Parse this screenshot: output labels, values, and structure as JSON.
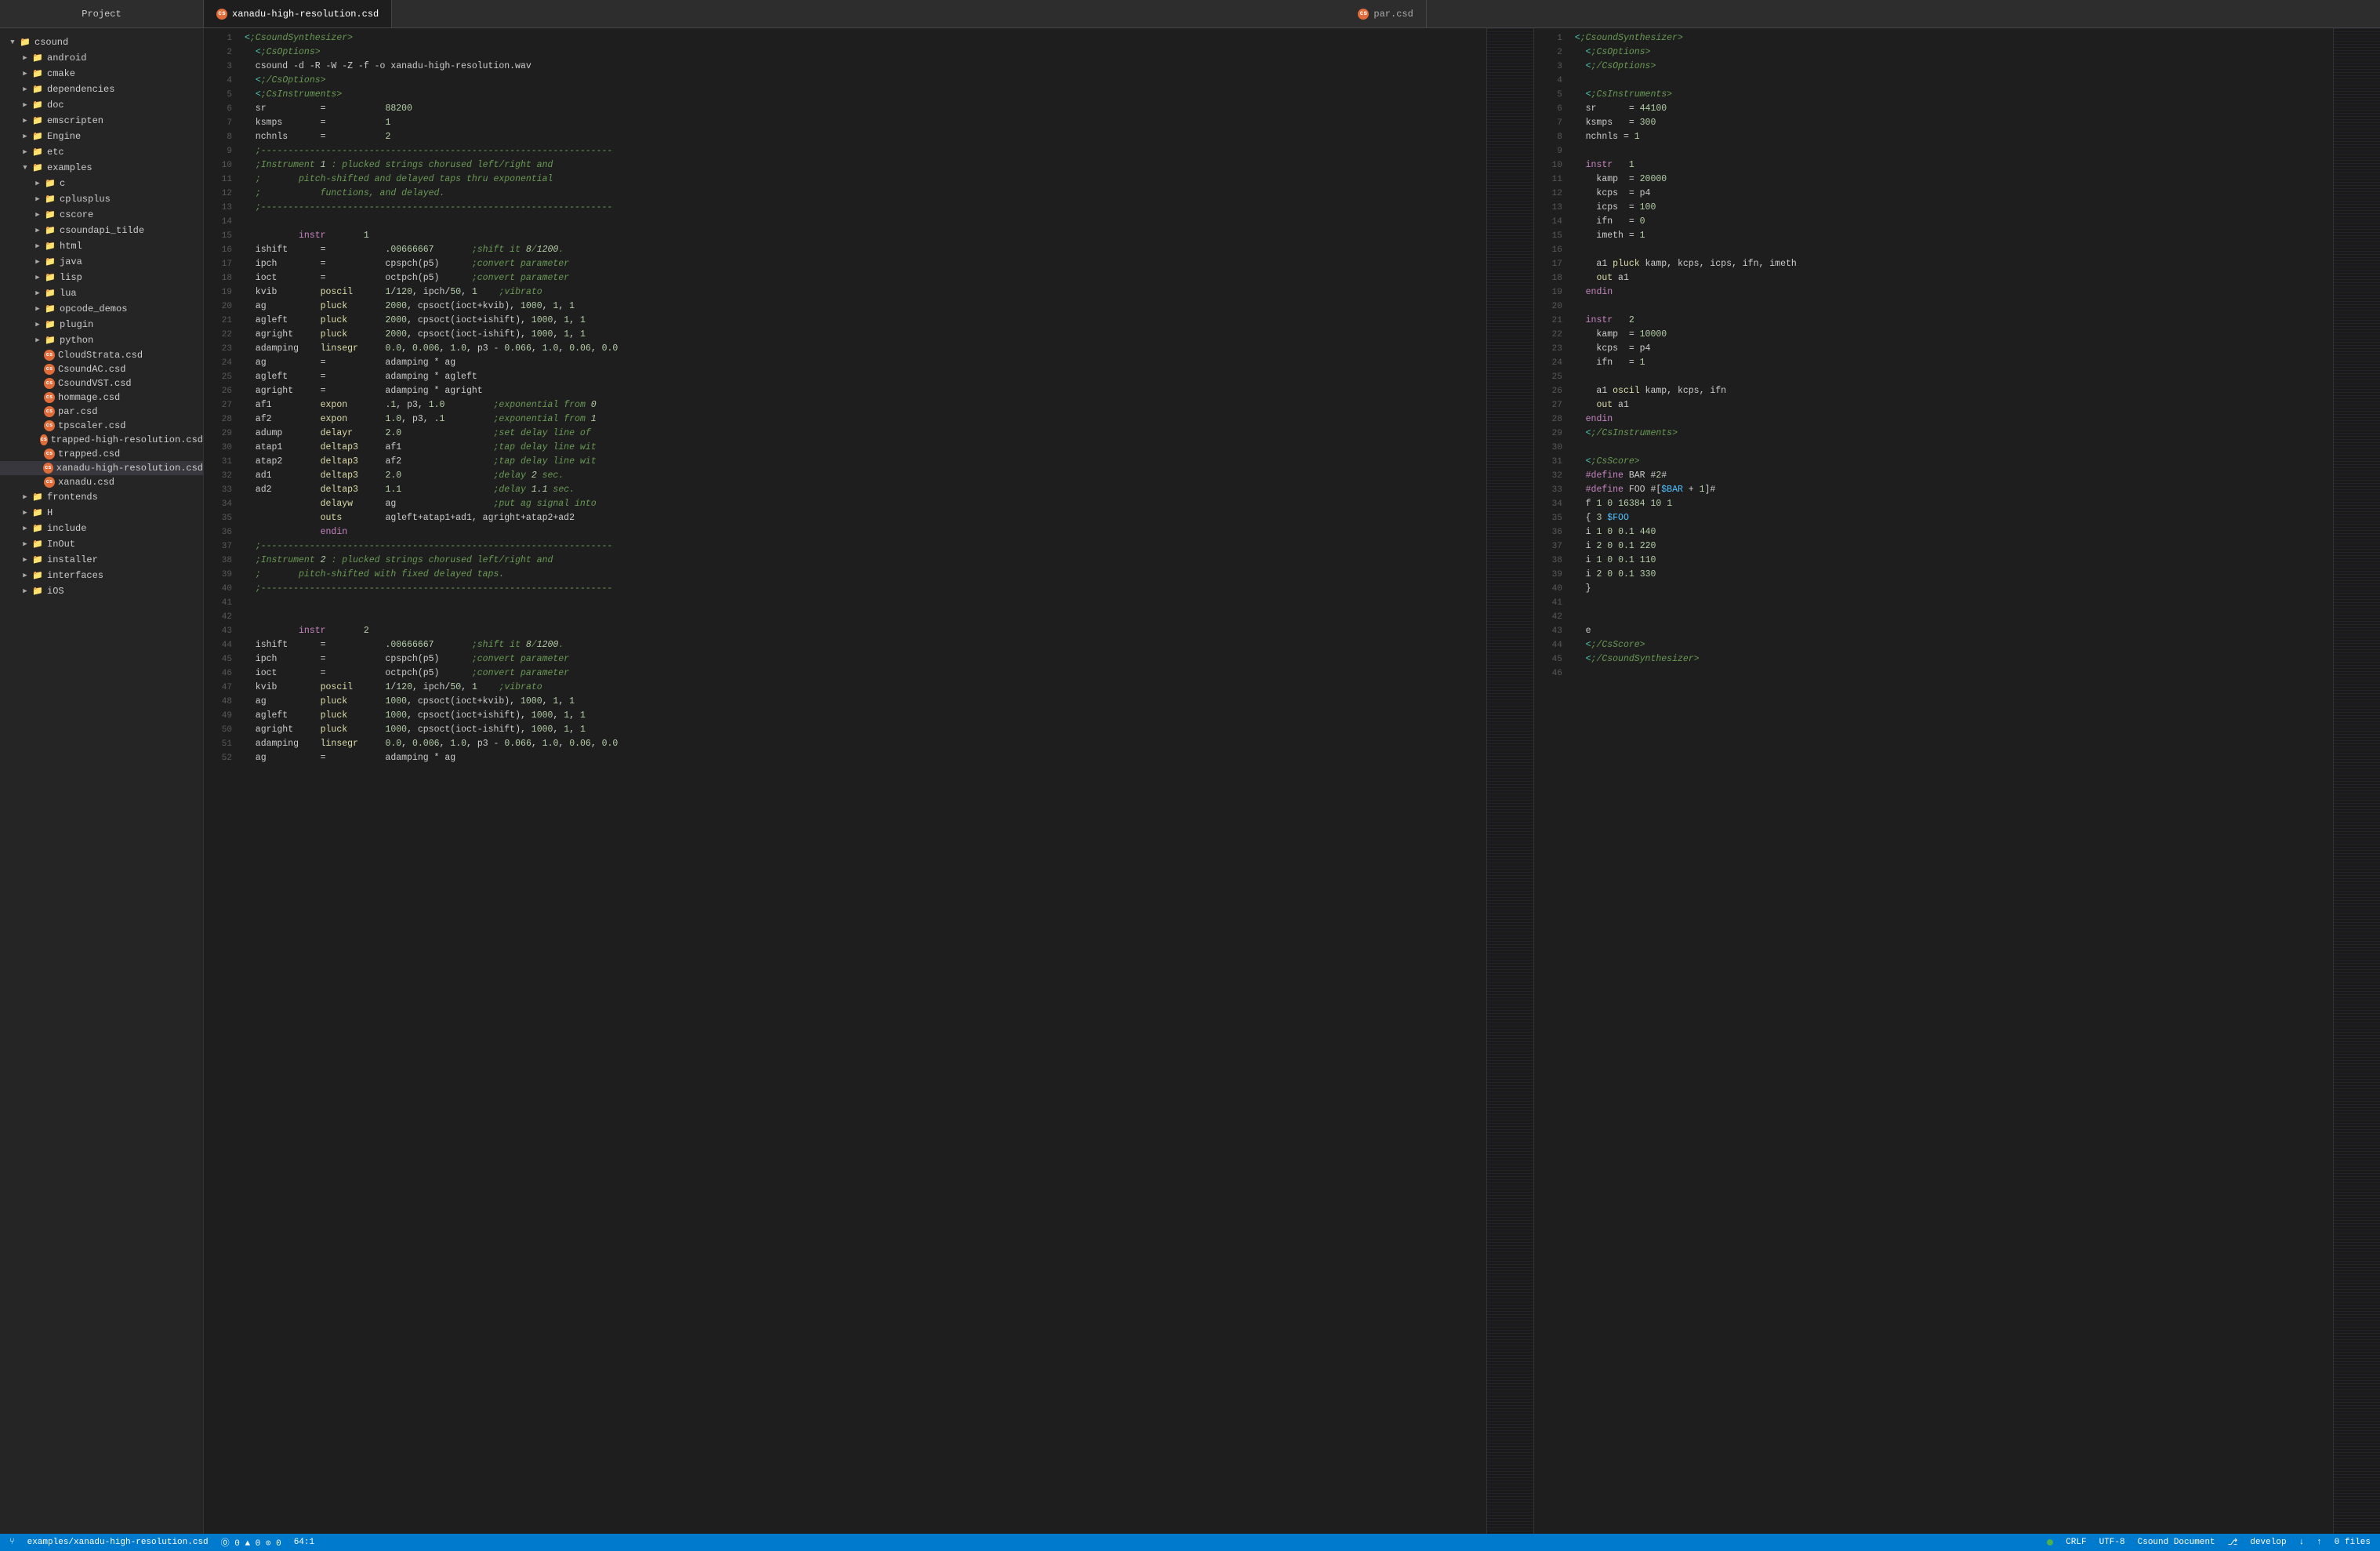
{
  "titleBar": {
    "tabs": [
      {
        "id": "xanadu",
        "label": "xanadu-high-resolution.csd",
        "active": true,
        "hasIcon": true
      },
      {
        "id": "par",
        "label": "par.csd",
        "active": false,
        "hasIcon": true
      }
    ]
  },
  "sidebar": {
    "title": "Project",
    "items": [
      {
        "id": "csound",
        "label": "csound",
        "type": "folder",
        "level": 0,
        "expanded": true,
        "arrow": "▼"
      },
      {
        "id": "android",
        "label": "android",
        "type": "folder",
        "level": 1,
        "expanded": false,
        "arrow": "▶"
      },
      {
        "id": "cmake",
        "label": "cmake",
        "type": "folder",
        "level": 1,
        "expanded": false,
        "arrow": "▶"
      },
      {
        "id": "dependencies",
        "label": "dependencies",
        "type": "folder",
        "level": 1,
        "expanded": false,
        "arrow": "▶"
      },
      {
        "id": "doc",
        "label": "doc",
        "type": "folder",
        "level": 1,
        "expanded": false,
        "arrow": "▶"
      },
      {
        "id": "emscripten",
        "label": "emscripten",
        "type": "folder",
        "level": 1,
        "expanded": false,
        "arrow": "▶"
      },
      {
        "id": "Engine",
        "label": "Engine",
        "type": "folder",
        "level": 1,
        "expanded": false,
        "arrow": "▶"
      },
      {
        "id": "etc",
        "label": "etc",
        "type": "folder",
        "level": 1,
        "expanded": false,
        "arrow": "▶"
      },
      {
        "id": "examples",
        "label": "examples",
        "type": "folder",
        "level": 1,
        "expanded": true,
        "arrow": "▼"
      },
      {
        "id": "c",
        "label": "c",
        "type": "folder",
        "level": 2,
        "expanded": false,
        "arrow": "▶"
      },
      {
        "id": "cplusplus",
        "label": "cplusplus",
        "type": "folder",
        "level": 2,
        "expanded": false,
        "arrow": "▶"
      },
      {
        "id": "cscore",
        "label": "cscore",
        "type": "folder",
        "level": 2,
        "expanded": false,
        "arrow": "▶"
      },
      {
        "id": "csoundapi_tilde",
        "label": "csoundapi_tilde",
        "type": "folder",
        "level": 2,
        "expanded": false,
        "arrow": "▶"
      },
      {
        "id": "html",
        "label": "html",
        "type": "folder",
        "level": 2,
        "expanded": false,
        "arrow": "▶"
      },
      {
        "id": "java",
        "label": "java",
        "type": "folder",
        "level": 2,
        "expanded": false,
        "arrow": "▶"
      },
      {
        "id": "lisp",
        "label": "lisp",
        "type": "folder",
        "level": 2,
        "expanded": false,
        "arrow": "▶"
      },
      {
        "id": "lua",
        "label": "lua",
        "type": "folder",
        "level": 2,
        "expanded": false,
        "arrow": "▶"
      },
      {
        "id": "opcode_demos",
        "label": "opcode_demos",
        "type": "folder",
        "level": 2,
        "expanded": false,
        "arrow": "▶"
      },
      {
        "id": "plugin",
        "label": "plugin",
        "type": "folder",
        "level": 2,
        "expanded": false,
        "arrow": "▶"
      },
      {
        "id": "python",
        "label": "python",
        "type": "folder",
        "level": 2,
        "expanded": false,
        "arrow": "▶"
      },
      {
        "id": "CloudStrata.csd",
        "label": "CloudStrata.csd",
        "type": "file-cs",
        "level": 2
      },
      {
        "id": "CsoundAC.csd",
        "label": "CsoundAC.csd",
        "type": "file-cs",
        "level": 2
      },
      {
        "id": "CsoundVST.csd",
        "label": "CsoundVST.csd",
        "type": "file-cs",
        "level": 2
      },
      {
        "id": "hommage.csd",
        "label": "hommage.csd",
        "type": "file-cs",
        "level": 2
      },
      {
        "id": "par.csd",
        "label": "par.csd",
        "type": "file-cs",
        "level": 2
      },
      {
        "id": "tpscaler.csd",
        "label": "tpscaler.csd",
        "type": "file-cs",
        "level": 2
      },
      {
        "id": "trapped-high-resolution.csd",
        "label": "trapped-high-resolution.csd",
        "type": "file-cs",
        "level": 2
      },
      {
        "id": "trapped.csd",
        "label": "trapped.csd",
        "type": "file-cs",
        "level": 2
      },
      {
        "id": "xanadu-high-resolution.csd",
        "label": "xanadu-high-resolution.csd",
        "type": "file-cs",
        "level": 2,
        "selected": true
      },
      {
        "id": "xanadu.csd",
        "label": "xanadu.csd",
        "type": "file-cs",
        "level": 2
      },
      {
        "id": "frontends",
        "label": "frontends",
        "type": "folder",
        "level": 1,
        "expanded": false,
        "arrow": "▶"
      },
      {
        "id": "H",
        "label": "H",
        "type": "folder",
        "level": 1,
        "expanded": false,
        "arrow": "▶"
      },
      {
        "id": "include",
        "label": "include",
        "type": "folder",
        "level": 1,
        "expanded": false,
        "arrow": "▶"
      },
      {
        "id": "InOut",
        "label": "InOut",
        "type": "folder",
        "level": 1,
        "expanded": false,
        "arrow": "▶"
      },
      {
        "id": "installer",
        "label": "installer",
        "type": "folder",
        "level": 1,
        "expanded": false,
        "arrow": "▶"
      },
      {
        "id": "interfaces",
        "label": "interfaces",
        "type": "folder",
        "level": 1,
        "expanded": false,
        "arrow": "▶"
      },
      {
        "id": "iOS",
        "label": "iOS",
        "type": "folder",
        "level": 1,
        "expanded": false,
        "arrow": "▶"
      }
    ]
  },
  "leftEditor": {
    "filename": "xanadu-high-resolution.csd",
    "lines": [
      {
        "n": 1,
        "code": "<CsoundSynthesizer>"
      },
      {
        "n": 2,
        "code": "  <CsOptions>"
      },
      {
        "n": 3,
        "code": "  csound -d -R -W -Z -f -o xanadu-high-resolution.wav"
      },
      {
        "n": 4,
        "code": "  </CsOptions>"
      },
      {
        "n": 5,
        "code": "  <CsInstruments>"
      },
      {
        "n": 6,
        "code": "  sr          =           88200"
      },
      {
        "n": 7,
        "code": "  ksmps       =           1"
      },
      {
        "n": 8,
        "code": "  nchnls      =           2"
      },
      {
        "n": 9,
        "code": "  ;-----------------------------------------------------------------"
      },
      {
        "n": 10,
        "code": "  ;Instrument 1 : plucked strings chorused left/right and"
      },
      {
        "n": 11,
        "code": "  ;       pitch-shifted and delayed taps thru exponential"
      },
      {
        "n": 12,
        "code": "  ;           functions, and delayed."
      },
      {
        "n": 13,
        "code": "  ;-----------------------------------------------------------------"
      },
      {
        "n": 14,
        "code": ""
      },
      {
        "n": 15,
        "code": "          instr       1"
      },
      {
        "n": 16,
        "code": "  ishift      =           .00666667       ;shift it 8/1200."
      },
      {
        "n": 17,
        "code": "  ipch        =           cpspch(p5)      ;convert parameter"
      },
      {
        "n": 18,
        "code": "  ioct        =           octpch(p5)      ;convert parameter"
      },
      {
        "n": 19,
        "code": "  kvib        poscil      1/120, ipch/50, 1    ;vibrato"
      },
      {
        "n": 20,
        "code": "  ag          pluck       2000, cpsoct(ioct+kvib), 1000, 1, 1"
      },
      {
        "n": 21,
        "code": "  agleft      pluck       2000, cpsoct(ioct+ishift), 1000, 1, 1"
      },
      {
        "n": 22,
        "code": "  agright     pluck       2000, cpsoct(ioct-ishift), 1000, 1, 1"
      },
      {
        "n": 23,
        "code": "  adamping    linsegr     0.0, 0.006, 1.0, p3 - 0.066, 1.0, 0.06, 0.0"
      },
      {
        "n": 24,
        "code": "  ag          =           adamping * ag"
      },
      {
        "n": 25,
        "code": "  agleft      =           adamping * agleft"
      },
      {
        "n": 26,
        "code": "  agright     =           adamping * agright"
      },
      {
        "n": 27,
        "code": "  af1         expon       .1, p3, 1.0         ;exponential from 0"
      },
      {
        "n": 28,
        "code": "  af2         expon       1.0, p3, .1         ;exponential from 1"
      },
      {
        "n": 29,
        "code": "  adump       delayr      2.0                 ;set delay line of"
      },
      {
        "n": 30,
        "code": "  atap1       deltap3     af1                 ;tap delay line wit"
      },
      {
        "n": 31,
        "code": "  atap2       deltap3     af2                 ;tap delay line wit"
      },
      {
        "n": 32,
        "code": "  ad1         deltap3     2.0                 ;delay 2 sec."
      },
      {
        "n": 33,
        "code": "  ad2         deltap3     1.1                 ;delay 1.1 sec."
      },
      {
        "n": 34,
        "code": "              delayw      ag                  ;put ag signal into"
      },
      {
        "n": 35,
        "code": "              outs        agleft+atap1+ad1, agright+atap2+ad2"
      },
      {
        "n": 36,
        "code": "              endin"
      },
      {
        "n": 37,
        "code": "  ;-----------------------------------------------------------------"
      },
      {
        "n": 38,
        "code": "  ;Instrument 2 : plucked strings chorused left/right and"
      },
      {
        "n": 39,
        "code": "  ;       pitch-shifted with fixed delayed taps."
      },
      {
        "n": 40,
        "code": "  ;-----------------------------------------------------------------"
      },
      {
        "n": 41,
        "code": ""
      },
      {
        "n": 42,
        "code": ""
      },
      {
        "n": 43,
        "code": "          instr       2"
      },
      {
        "n": 44,
        "code": "  ishift      =           .00666667       ;shift it 8/1200."
      },
      {
        "n": 45,
        "code": "  ipch        =           cpspch(p5)      ;convert parameter"
      },
      {
        "n": 46,
        "code": "  ioct        =           octpch(p5)      ;convert parameter"
      },
      {
        "n": 47,
        "code": "  kvib        poscil      1/120, ipch/50, 1    ;vibrato"
      },
      {
        "n": 48,
        "code": "  ag          pluck       1000, cpsoct(ioct+kvib), 1000, 1, 1"
      },
      {
        "n": 49,
        "code": "  agleft      pluck       1000, cpsoct(ioct+ishift), 1000, 1, 1"
      },
      {
        "n": 50,
        "code": "  agright     pluck       1000, cpsoct(ioct-ishift), 1000, 1, 1"
      },
      {
        "n": 51,
        "code": "  adamping    linsegr     0.0, 0.006, 1.0, p3 - 0.066, 1.0, 0.06, 0.0"
      },
      {
        "n": 52,
        "code": "  ag          =           adamping * ag"
      }
    ]
  },
  "rightEditor": {
    "filename": "par.csd",
    "lines": [
      {
        "n": 1,
        "code": "<CsoundSynthesizer>"
      },
      {
        "n": 2,
        "code": "  <CsOptions>"
      },
      {
        "n": 3,
        "code": "  </CsOptions>"
      },
      {
        "n": 4,
        "code": ""
      },
      {
        "n": 5,
        "code": "  <CsInstruments>"
      },
      {
        "n": 6,
        "code": "  sr      = 44100"
      },
      {
        "n": 7,
        "code": "  ksmps   = 300"
      },
      {
        "n": 8,
        "code": "  nchnls = 1"
      },
      {
        "n": 9,
        "code": ""
      },
      {
        "n": 10,
        "code": "  instr   1"
      },
      {
        "n": 11,
        "code": "    kamp  = 20000"
      },
      {
        "n": 12,
        "code": "    kcps  = p4"
      },
      {
        "n": 13,
        "code": "    icps  = 100"
      },
      {
        "n": 14,
        "code": "    ifn   = 0"
      },
      {
        "n": 15,
        "code": "    imeth = 1"
      },
      {
        "n": 16,
        "code": ""
      },
      {
        "n": 17,
        "code": "    a1 pluck kamp, kcps, icps, ifn, imeth"
      },
      {
        "n": 18,
        "code": "    out a1"
      },
      {
        "n": 19,
        "code": "  endin"
      },
      {
        "n": 20,
        "code": ""
      },
      {
        "n": 21,
        "code": "  instr   2"
      },
      {
        "n": 22,
        "code": "    kamp  = 10000"
      },
      {
        "n": 23,
        "code": "    kcps  = p4"
      },
      {
        "n": 24,
        "code": "    ifn   = 1"
      },
      {
        "n": 25,
        "code": ""
      },
      {
        "n": 26,
        "code": "    a1 oscil kamp, kcps, ifn"
      },
      {
        "n": 27,
        "code": "    out a1"
      },
      {
        "n": 28,
        "code": "  endin"
      },
      {
        "n": 29,
        "code": "  </CsInstruments>"
      },
      {
        "n": 30,
        "code": ""
      },
      {
        "n": 31,
        "code": "  <CsScore>"
      },
      {
        "n": 32,
        "code": "  #define BAR #2#"
      },
      {
        "n": 33,
        "code": "  #define FOO #[$BAR + 1]#"
      },
      {
        "n": 34,
        "code": "  f 1 0 16384 10 1"
      },
      {
        "n": 35,
        "code": "  { 3 $FOO"
      },
      {
        "n": 36,
        "code": "  i 1 0 0.1 440"
      },
      {
        "n": 37,
        "code": "  i 2 0 0.1 220"
      },
      {
        "n": 38,
        "code": "  i 1 0 0.1 110"
      },
      {
        "n": 39,
        "code": "  i 2 0 0.1 330"
      },
      {
        "n": 40,
        "code": "  }"
      },
      {
        "n": 41,
        "code": ""
      },
      {
        "n": 42,
        "code": ""
      },
      {
        "n": 43,
        "code": "  e"
      },
      {
        "n": 44,
        "code": "  </CsScore>"
      },
      {
        "n": 45,
        "code": "  </CsoundSynthesizer>"
      },
      {
        "n": 46,
        "code": ""
      }
    ]
  },
  "statusBar": {
    "filepath": "examples/xanadu-high-resolution.csd",
    "errors": "⓪ 0  ▲ 0  ⊙ 0",
    "position": "64:1",
    "lineEnding": "CRLF",
    "encoding": "UTF-8",
    "language": "Csound Document",
    "branch": "develop",
    "filesChanged": "0 files"
  }
}
